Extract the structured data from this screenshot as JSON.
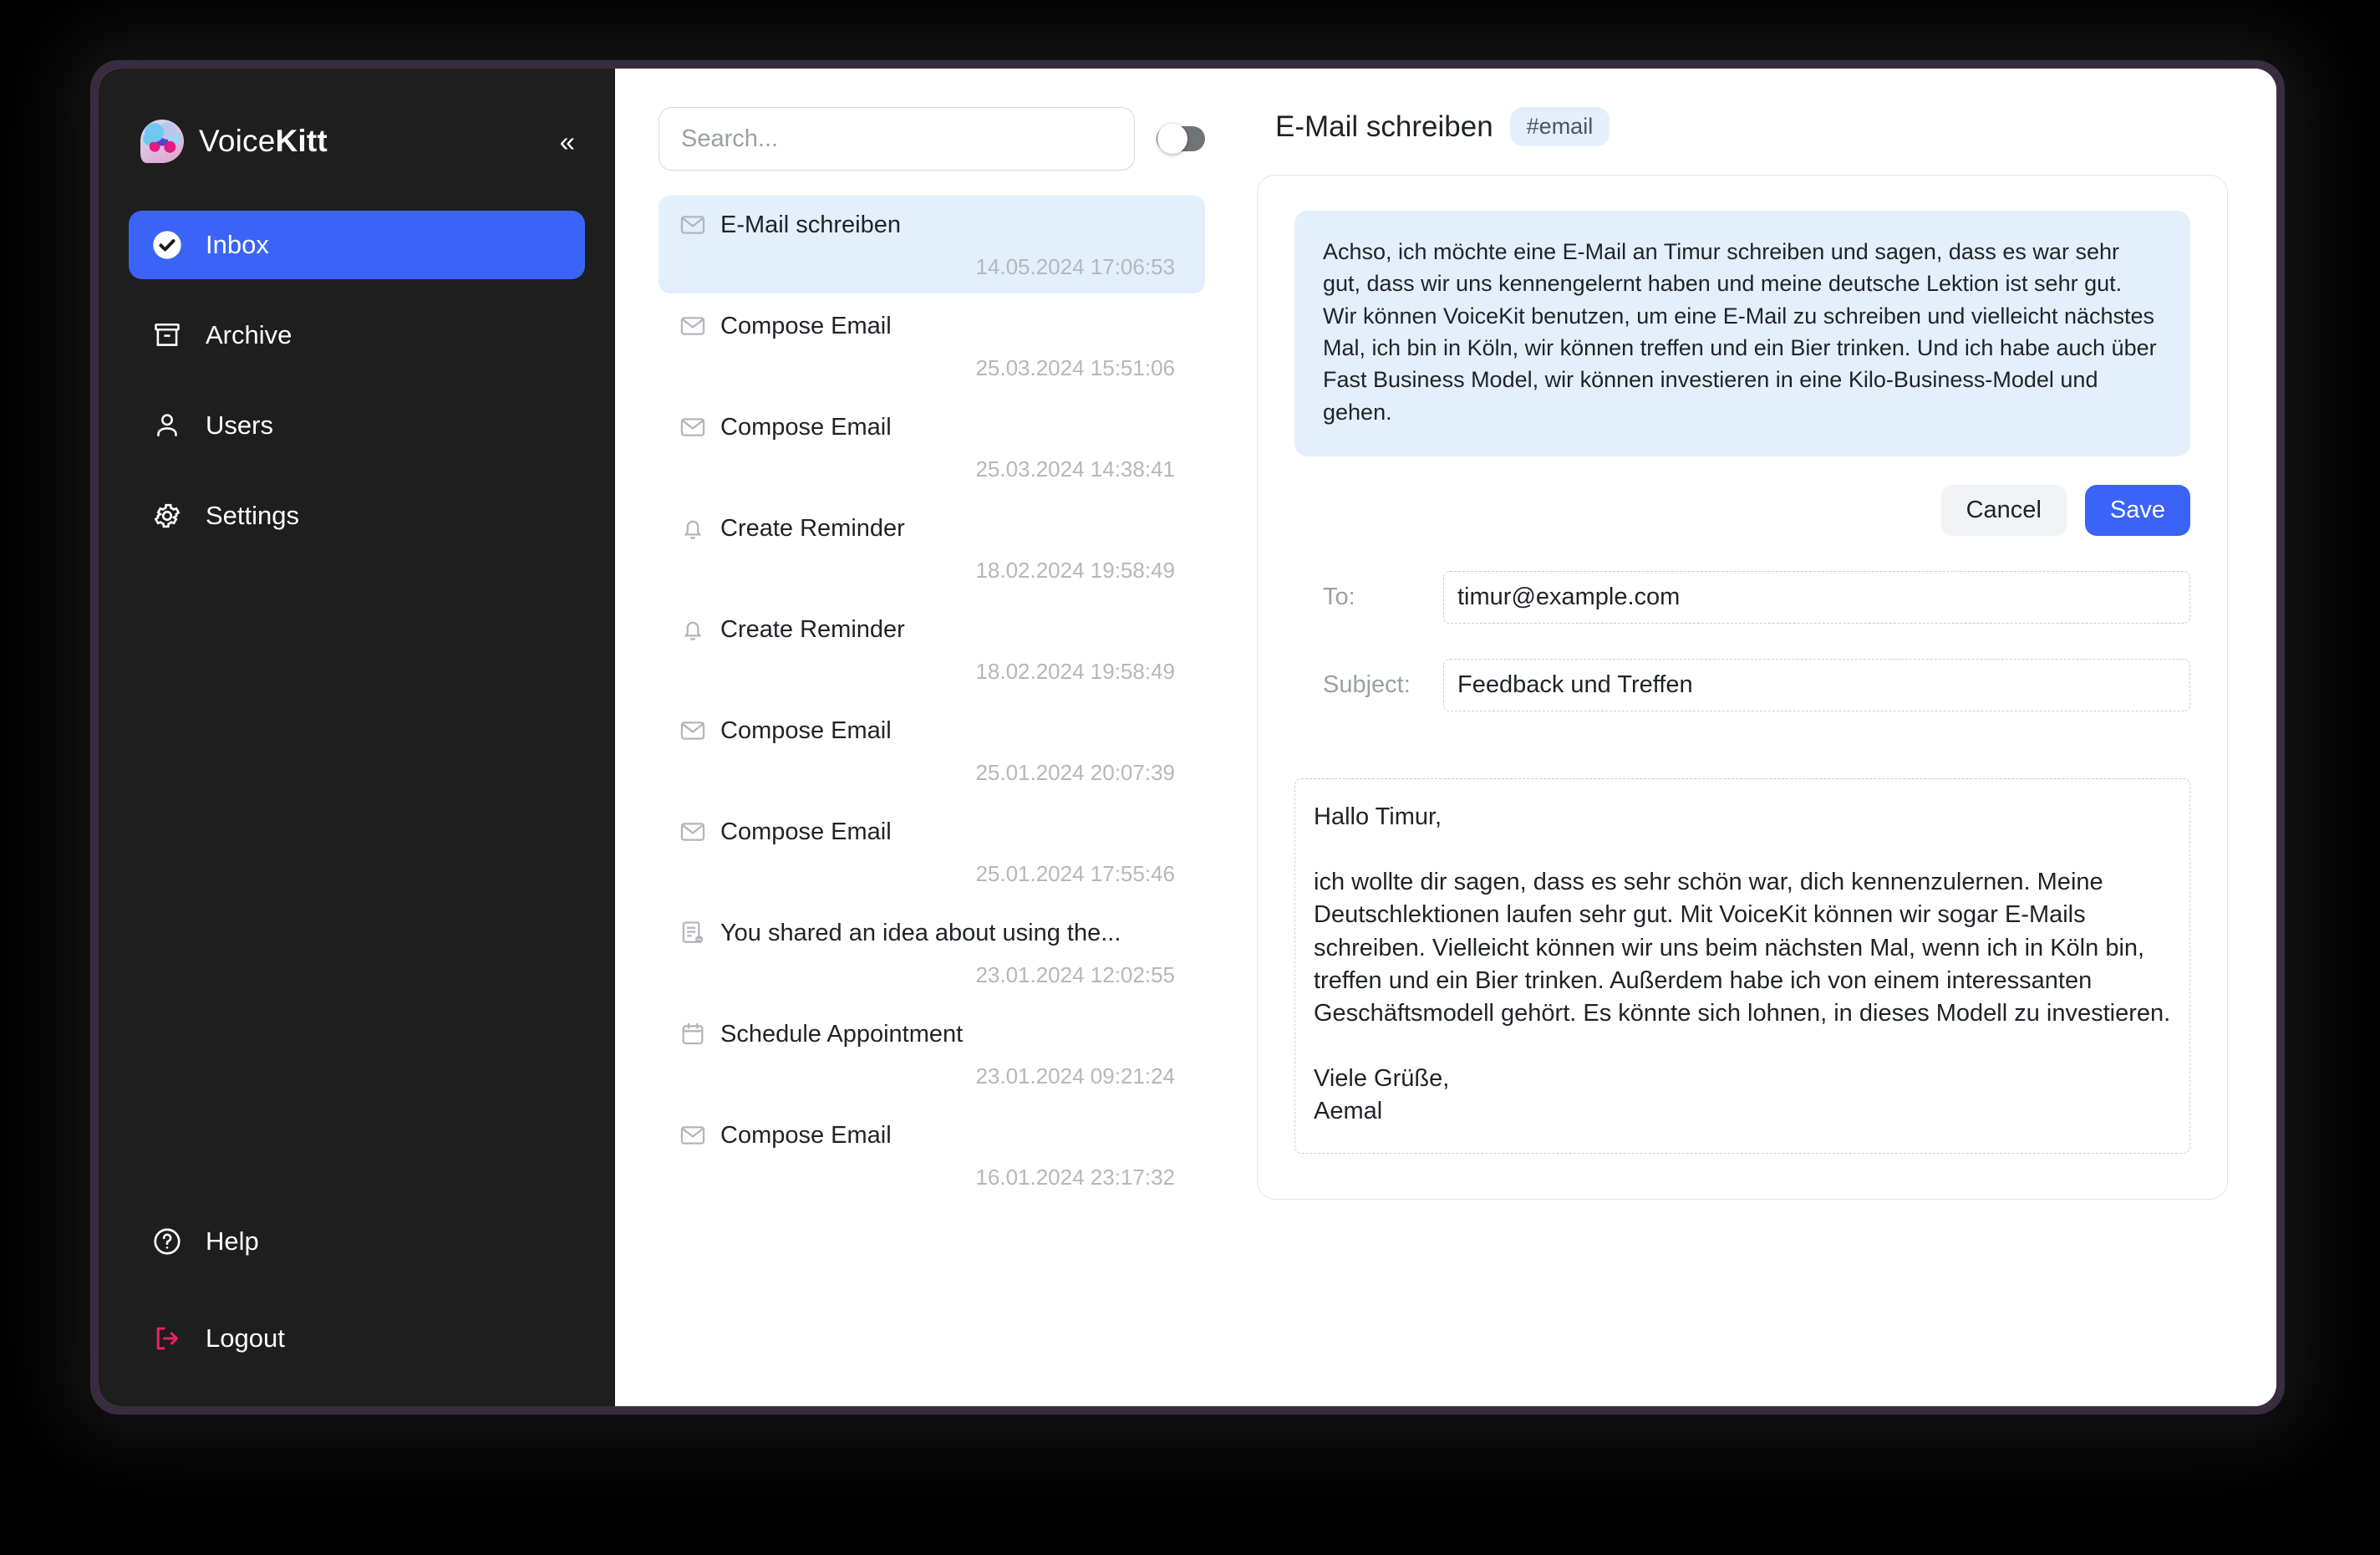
{
  "app": {
    "brand_prefix": "Voice",
    "brand_suffix": "Kitt",
    "collapse_icon": "«"
  },
  "sidebar": {
    "primary_items": [
      {
        "label": "Inbox",
        "icon": "check-circle-icon",
        "active": true
      },
      {
        "label": "Archive",
        "icon": "archive-box-icon",
        "active": false
      },
      {
        "label": "Users",
        "icon": "user-icon",
        "active": false
      },
      {
        "label": "Settings",
        "icon": "gear-icon",
        "active": false
      }
    ],
    "secondary_items": [
      {
        "label": "Help",
        "icon": "question-circle-icon"
      },
      {
        "label": "Logout",
        "icon": "logout-arrow-icon"
      }
    ],
    "active_color": "#3b63f6",
    "logout_color": "#f01f5e",
    "background": "#1e1e1e"
  },
  "list": {
    "search_placeholder": "Search...",
    "search_value": "",
    "toggle_on": false,
    "items": [
      {
        "title": "E-Mail schreiben",
        "date": "14.05.2024 17:06:53",
        "icon": "mail-icon",
        "selected": true
      },
      {
        "title": "Compose Email",
        "date": "25.03.2024 15:51:06",
        "icon": "mail-icon",
        "selected": false
      },
      {
        "title": "Compose Email",
        "date": "25.03.2024 14:38:41",
        "icon": "mail-icon",
        "selected": false
      },
      {
        "title": "Create Reminder",
        "date": "18.02.2024 19:58:49",
        "icon": "bell-icon",
        "selected": false
      },
      {
        "title": "Create Reminder",
        "date": "18.02.2024 19:58:49",
        "icon": "bell-icon",
        "selected": false
      },
      {
        "title": "Compose Email",
        "date": "25.01.2024 20:07:39",
        "icon": "mail-icon",
        "selected": false
      },
      {
        "title": "Compose Email",
        "date": "25.01.2024 17:55:46",
        "icon": "mail-icon",
        "selected": false
      },
      {
        "title": "You shared an idea about using the...",
        "date": "23.01.2024 12:02:55",
        "icon": "note-icon",
        "selected": false
      },
      {
        "title": "Schedule Appointment",
        "date": "23.01.2024 09:21:24",
        "icon": "calendar-icon",
        "selected": false
      },
      {
        "title": "Compose Email",
        "date": "16.01.2024 23:17:32",
        "icon": "mail-icon",
        "selected": false
      }
    ]
  },
  "detail": {
    "title": "E-Mail schreiben",
    "tag": "#email",
    "transcript": "Achso, ich möchte eine E-Mail an Timur schreiben und sagen, dass es war sehr gut, dass wir uns kennengelernt haben und meine deutsche Lektion ist sehr gut. Wir können VoiceKit benutzen, um eine E-Mail zu schreiben und vielleicht nächstes Mal, ich bin in Köln, wir können treffen und ein Bier trinken. Und ich habe auch über Fast Business Model, wir können investieren in eine Kilo-Business-Model und gehen.",
    "cancel_label": "Cancel",
    "save_label": "Save",
    "to_label": "To:",
    "to_value": "timur@example.com",
    "subject_label": "Subject:",
    "subject_value": "Feedback und Treffen",
    "body_value": "Hallo Timur,\n\nich wollte dir sagen, dass es sehr schön war, dich kennenzulernen. Meine Deutschlektionen laufen sehr gut. Mit VoiceKit können wir sogar E-Mails schreiben. Vielleicht können wir uns beim nächsten Mal, wenn ich in Köln bin, treffen und ein Bier trinken. Außerdem habe ich von einem interessanten Geschäftsmodell gehört. Es könnte sich lohnen, in dieses Modell zu investieren.\n\nViele Grüße,\nAemal"
  }
}
